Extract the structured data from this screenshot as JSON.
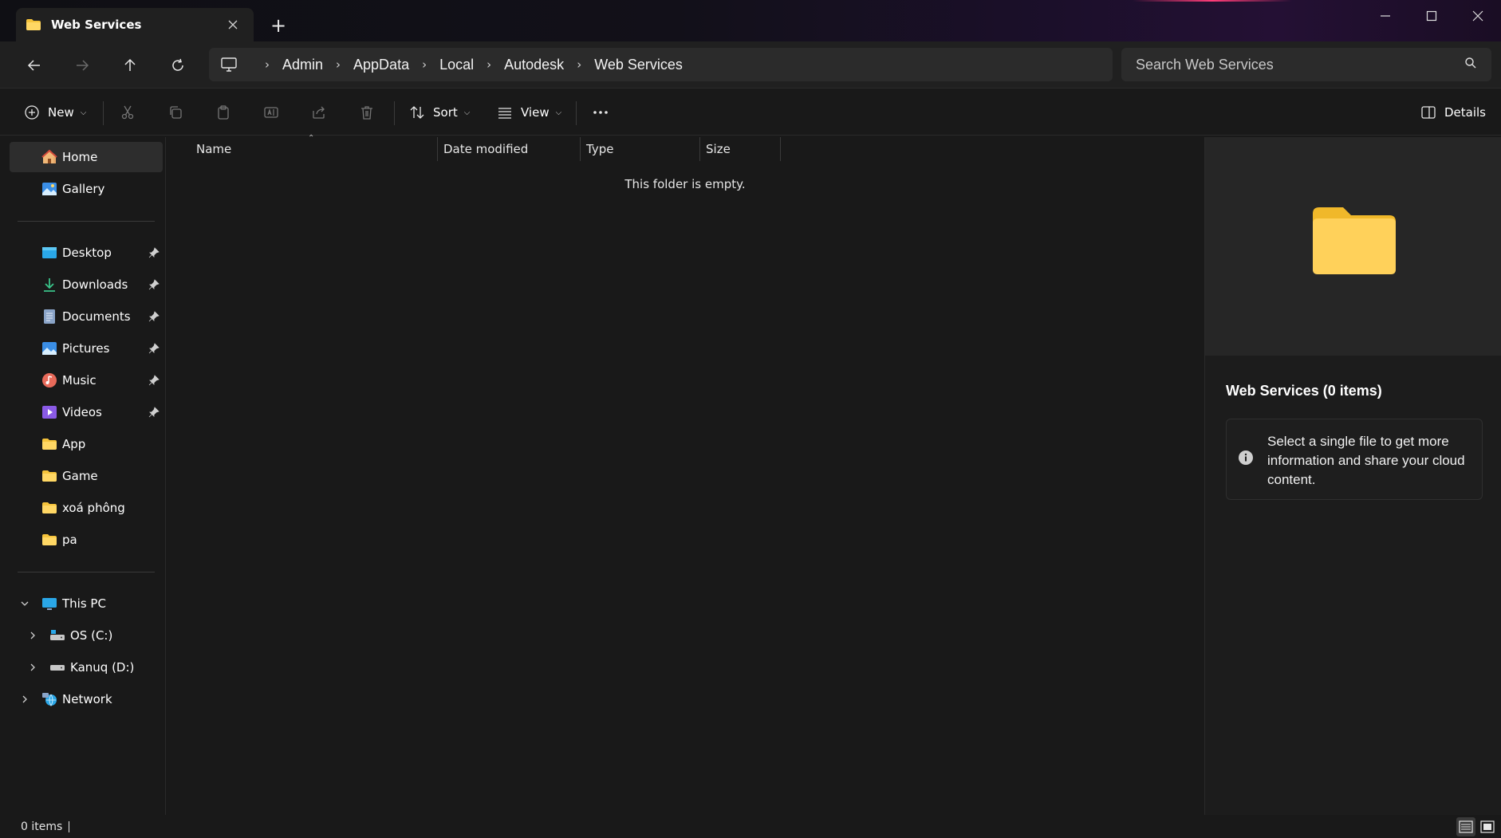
{
  "window": {
    "tab_title": "Web Services",
    "new_tab_symbol": "+"
  },
  "address": {
    "crumbs": [
      "Admin",
      "AppData",
      "Local",
      "Autodesk",
      "Web Services"
    ],
    "search_placeholder": "Search Web Services"
  },
  "toolbar": {
    "new_label": "New",
    "sort_label": "Sort",
    "view_label": "View",
    "details_label": "Details"
  },
  "sidebar": {
    "home": "Home",
    "gallery": "Gallery",
    "pinned": [
      "Desktop",
      "Downloads",
      "Documents",
      "Pictures",
      "Music",
      "Videos"
    ],
    "folders": [
      "App",
      "Game",
      "xoá phông",
      "pa"
    ],
    "this_pc": "This PC",
    "drives": [
      "OS (C:)",
      "Kanuq (D:)"
    ],
    "network": "Network"
  },
  "content": {
    "columns": [
      "Name",
      "Date modified",
      "Type",
      "Size"
    ],
    "empty_message": "This folder is empty."
  },
  "details": {
    "title": "Web Services (0 items)",
    "info": "Select a single file to get more information and share your cloud content."
  },
  "status": {
    "item_count": "0 items"
  },
  "colors": {
    "folder_yellow": "#f5c33b",
    "background": "#191919",
    "pane": "#262626"
  }
}
